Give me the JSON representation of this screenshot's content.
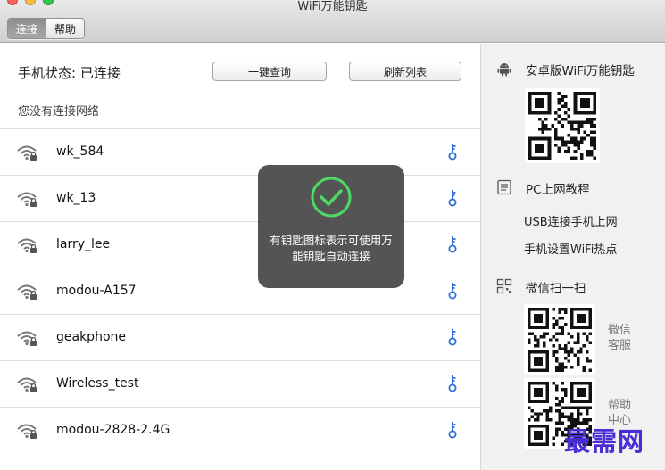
{
  "window": {
    "title": "WiFi万能钥匙"
  },
  "toolbar": {
    "tabs": [
      {
        "label": "连接"
      },
      {
        "label": "帮助"
      }
    ]
  },
  "main": {
    "status_label": "手机状态: 已连接",
    "query_button": "一键查询",
    "refresh_button": "刷新列表",
    "no_connection_text": "您没有连接网络",
    "networks": [
      {
        "ssid": "wk_584"
      },
      {
        "ssid": "wk_13"
      },
      {
        "ssid": "larry_lee"
      },
      {
        "ssid": "modou-A157"
      },
      {
        "ssid": "geakphone"
      },
      {
        "ssid": "Wireless_test"
      },
      {
        "ssid": "modou-2828-2.4G"
      }
    ]
  },
  "toast": {
    "message": "有钥匙图标表示可使用万能钥匙自动连接"
  },
  "sidebar": {
    "android_title": "安卓版WiFi万能钥匙",
    "pc_title": "PC上网教程",
    "pc_links": [
      "USB连接手机上网",
      "手机设置WiFi热点"
    ],
    "wechat_title": "微信扫一扫",
    "wechat_service_label": "微信客服",
    "help_center_label": "帮助中心"
  },
  "watermark": "最需网",
  "colors": {
    "accent_blue": "#2f6fd6",
    "toast_check_green": "#4cd964",
    "watermark": "#4a2bd6"
  }
}
